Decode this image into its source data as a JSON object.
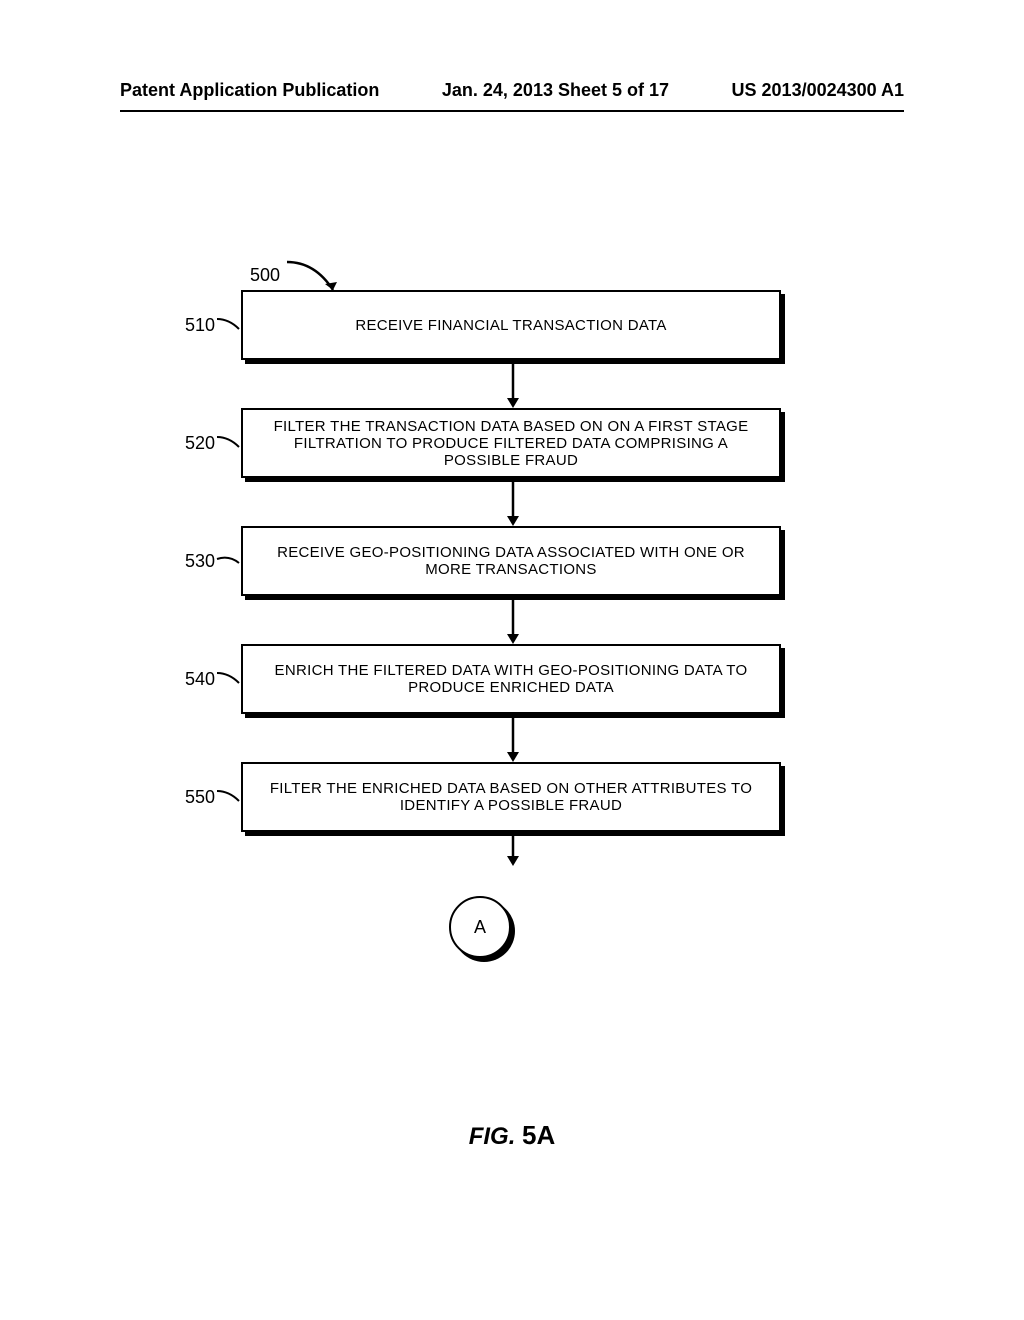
{
  "header": {
    "left": "Patent Application Publication",
    "center": "Jan. 24, 2013  Sheet 5 of 17",
    "right": "US 2013/0024300 A1"
  },
  "diagram": {
    "leader_ref": "500",
    "steps": [
      {
        "ref": "510",
        "text": "RECEIVE FINANCIAL TRANSACTION DATA"
      },
      {
        "ref": "520",
        "text": "FILTER THE TRANSACTION DATA BASED ON ON A FIRST STAGE FILTRATION TO PRODUCE FILTERED DATA COMPRISING A POSSIBLE FRAUD"
      },
      {
        "ref": "530",
        "text": "RECEIVE GEO-POSITIONING DATA ASSOCIATED WITH ONE OR MORE TRANSACTIONS"
      },
      {
        "ref": "540",
        "text": "ENRICH THE FILTERED DATA WITH GEO-POSITIONING DATA TO PRODUCE ENRICHED DATA"
      },
      {
        "ref": "550",
        "text": "FILTER THE ENRICHED DATA BASED ON OTHER ATTRIBUTES TO IDENTIFY A POSSIBLE FRAUD"
      }
    ],
    "connector": "A"
  },
  "figure_label": {
    "prefix": "FIG. ",
    "number": "5A"
  }
}
